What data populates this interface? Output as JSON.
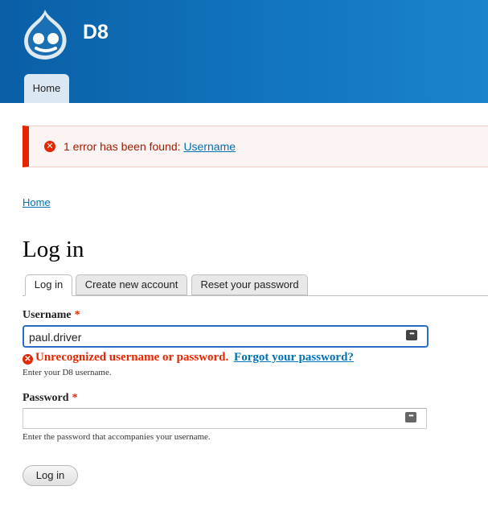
{
  "header": {
    "site_name": "D8",
    "nav": {
      "home_label": "Home"
    }
  },
  "messages": {
    "error_prefix": "1 error has been found:",
    "error_link": "Username"
  },
  "breadcrumb": {
    "home": "Home"
  },
  "page": {
    "title": "Log in"
  },
  "tabs": [
    {
      "label": "Log in",
      "active": true
    },
    {
      "label": "Create new account",
      "active": false
    },
    {
      "label": "Reset your password",
      "active": false
    }
  ],
  "form": {
    "username": {
      "label": "Username",
      "required_mark": "*",
      "value": "paul.driver",
      "error": "Unrecognized username or password.",
      "error_link": "Forgot your password?",
      "description": "Enter your D8 username."
    },
    "password": {
      "label": "Password",
      "required_mark": "*",
      "value": "",
      "description": "Enter the password that accompanies your username."
    },
    "submit_label": "Log in"
  },
  "colors": {
    "header": "#1276c0",
    "error": "#e62600",
    "link": "#0071b3"
  },
  "icons": [
    "drupal-logo-icon",
    "error-icon",
    "password-manager-icon"
  ]
}
